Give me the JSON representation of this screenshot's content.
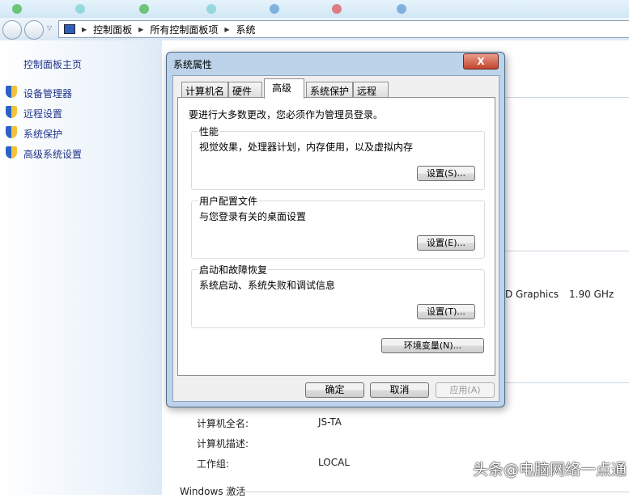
{
  "breadcrumb": [
    "控制面板",
    "所有控制面板项",
    "系统"
  ],
  "sidebar": {
    "home": "控制面板主页",
    "items": [
      "设备管理器",
      "远程设置",
      "系统保护",
      "高级系统设置"
    ]
  },
  "background": {
    "graphics": "D Graphics",
    "speed": "1.90 GHz",
    "rows": [
      {
        "label": "计算机全名:",
        "value": "JS-TA"
      },
      {
        "label": "计算机描述:",
        "value": ""
      },
      {
        "label": "工作组:",
        "value": "LOCAL"
      }
    ],
    "activation": "Windows 激活"
  },
  "dialog": {
    "title": "系统属性",
    "close": "X",
    "tabs": [
      "计算机名",
      "硬件",
      "高级",
      "系统保护",
      "远程"
    ],
    "notice": "要进行大多数更改，您必须作为管理员登录。",
    "groups": [
      {
        "label": "性能",
        "desc": "视觉效果，处理器计划，内存使用，以及虚拟内存",
        "button": "设置(S)..."
      },
      {
        "label": "用户配置文件",
        "desc": "与您登录有关的桌面设置",
        "button": "设置(E)..."
      },
      {
        "label": "启动和故障恢复",
        "desc": "系统启动、系统失败和调试信息",
        "button": "设置(T)..."
      }
    ],
    "env_button": "环境变量(N)...",
    "ok": "确定",
    "cancel": "取消",
    "apply": "应用(A)"
  },
  "watermark": "头条@电脑网络一点通"
}
